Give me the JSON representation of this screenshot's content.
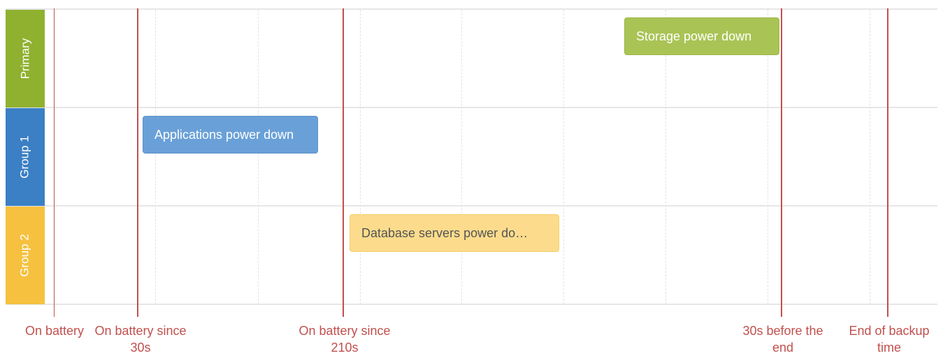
{
  "lanes": [
    {
      "label": "Primary",
      "color": "#8fb12f"
    },
    {
      "label": "Group 1",
      "color": "#3b7fc4"
    },
    {
      "label": "Group 2",
      "color": "#f5c13f"
    }
  ],
  "events": [
    {
      "label": "Storage power down",
      "lane": "Primary",
      "color": "#a9c455"
    },
    {
      "label": "Applications power down",
      "lane": "Group 1",
      "color": "#6aa0d8"
    },
    {
      "label": "Database servers power do…",
      "lane": "Group 2",
      "color": "#fcdc8c"
    }
  ],
  "markers": [
    {
      "label_line1": "On battery",
      "label_line2": ""
    },
    {
      "label_line1": "On battery since",
      "label_line2": "30s"
    },
    {
      "label_line1": "On battery since",
      "label_line2": "210s"
    },
    {
      "label_line1": "30s before the",
      "label_line2": "end"
    },
    {
      "label_line1": "End of backup",
      "label_line2": "time"
    }
  ],
  "marker_color": "#c0504d"
}
